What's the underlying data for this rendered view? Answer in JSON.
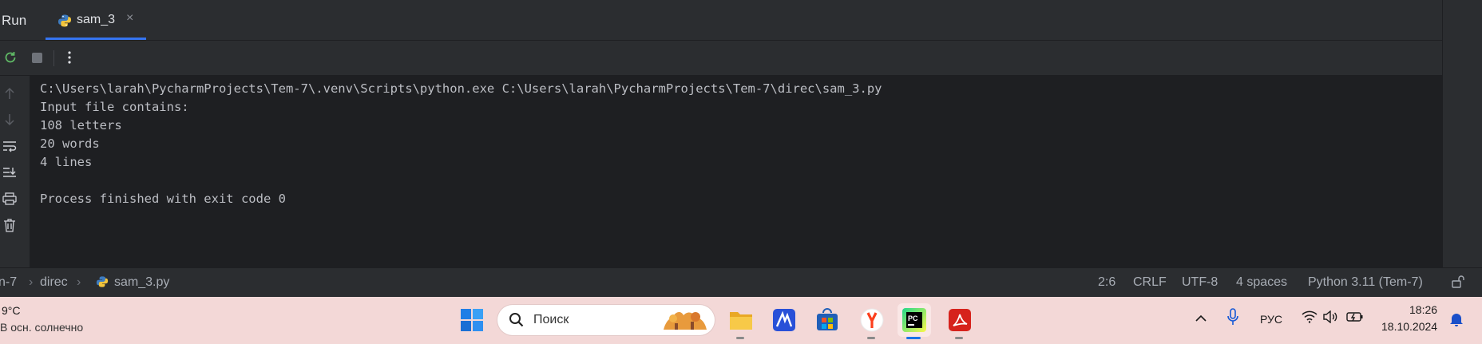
{
  "ide": {
    "tool_window": "Run",
    "tab": {
      "label": "sam_3",
      "icon": "python-icon",
      "close": "×"
    },
    "toolbar": {
      "rerun": "rerun-icon",
      "stop": "stop-icon",
      "more": "more-vertical-icon"
    },
    "gutter_icons": [
      "arrow-up-icon",
      "arrow-down-icon",
      "soft-wrap-icon",
      "scroll-to-end-icon",
      "print-icon",
      "trash-icon"
    ],
    "console_lines": [
      "C:\\Users\\larah\\PycharmProjects\\Tem-7\\.venv\\Scripts\\python.exe C:\\Users\\larah\\PycharmProjects\\Tem-7\\direc\\sam_3.py",
      "Input file contains:",
      "108 letters",
      "20 words",
      "4 lines",
      "",
      "Process finished with exit code 0"
    ],
    "status_bar": {
      "breadcrumb": [
        "n-7",
        "direc",
        "sam_3.py"
      ],
      "caret": "2:6",
      "line_ending": "CRLF",
      "encoding": "UTF-8",
      "indent": "4 spaces",
      "interpreter": "Python 3.11 (Tem-7)",
      "lock_icon": "unlock-icon"
    }
  },
  "taskbar": {
    "weather": {
      "temp": "9°C",
      "desc": "В осн. солнечно"
    },
    "search_placeholder": "Поиск",
    "apps": [
      "start-icon",
      "file-explorer-icon",
      "editor-icon",
      "store-icon",
      "yandex-browser-icon",
      "pycharm-icon",
      "pdf-reader-icon"
    ],
    "tray": {
      "language": "РУС",
      "time": "18:26",
      "date": "18.10.2024"
    }
  },
  "colors": {
    "accent": "#3574f0",
    "ide_bg": "#1e1f22",
    "panel_bg": "#2b2d30",
    "taskbar_bg": "#f3d8d7"
  }
}
